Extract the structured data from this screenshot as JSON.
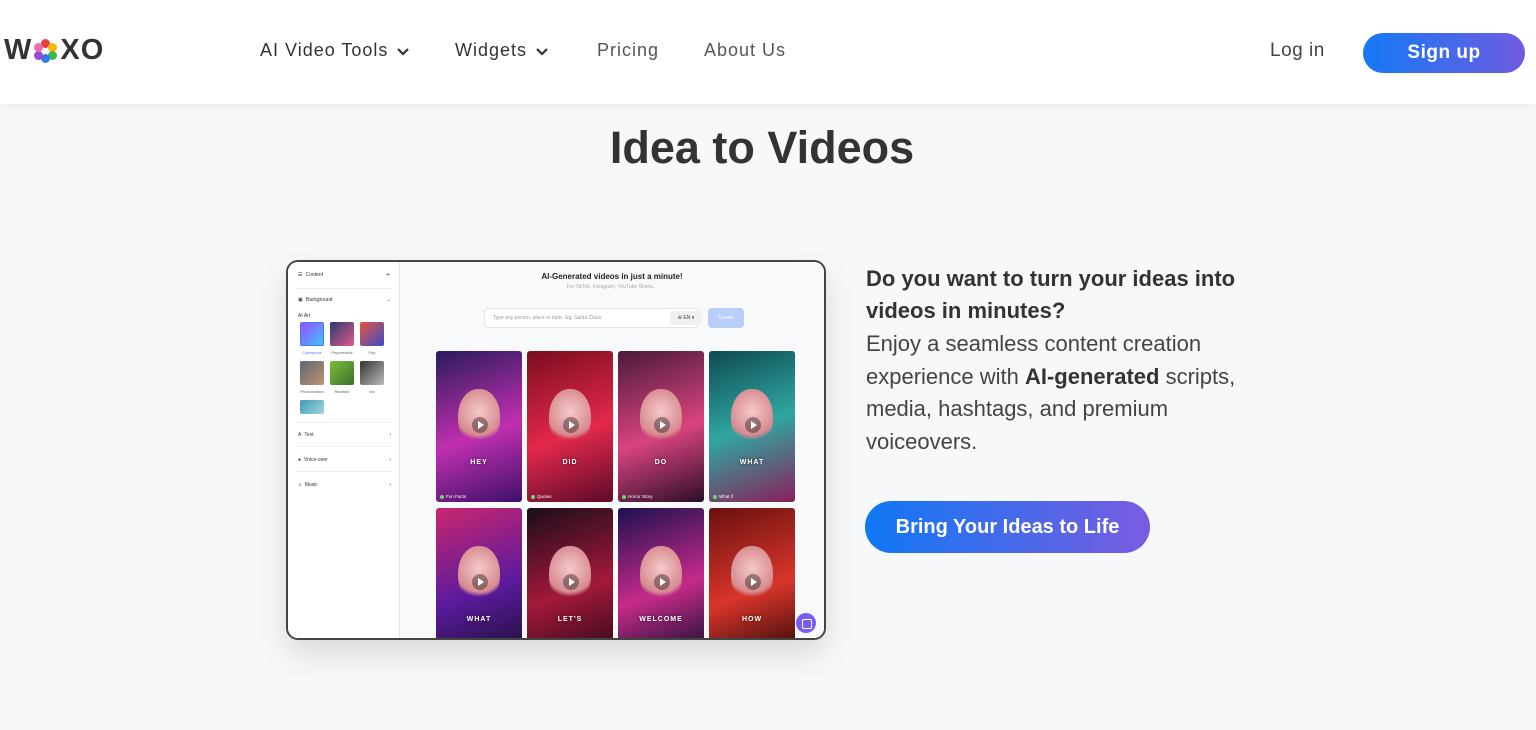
{
  "brand": {
    "logo_prefix": "W",
    "logo_suffix": "XO",
    "accent_gradient": [
      "#1479f5",
      "#6f5ce0"
    ],
    "flower_colors": [
      "#e8403f",
      "#f7b500",
      "#3cb94a",
      "#2f7be8",
      "#9a4ad6",
      "#ef6bb0"
    ]
  },
  "nav": {
    "items": [
      {
        "label": "AI Video Tools",
        "has_dropdown": true
      },
      {
        "label": "Widgets",
        "has_dropdown": true
      },
      {
        "label": "Pricing",
        "has_dropdown": false
      },
      {
        "label": "About Us",
        "has_dropdown": false
      }
    ],
    "login_label": "Log in",
    "signup_label": "Sign up"
  },
  "hero": {
    "title": "Idea to Videos"
  },
  "mockup": {
    "sidebar": {
      "content_label": "Content",
      "background_label": "Background",
      "ai_art_label": "AI Art",
      "styles": [
        "Cyberpunk",
        "Psychedelic",
        "Pop",
        "Photorealism",
        "Realistic",
        "Ink"
      ],
      "text_label": "Text",
      "voiceover_label": "Voice-over",
      "music_label": "Music"
    },
    "heading": "AI-Generated videos in just a minute!",
    "subheading": "For TikTok, Instagram, YouTube Shorts...",
    "input_placeholder": "Type any person, place or topic. Eg. Santa Claus",
    "language": "EN",
    "create_label": "Create",
    "cards": [
      {
        "caption": "HEY",
        "tag": "Fun Facts"
      },
      {
        "caption": "DID",
        "tag": "Quotes"
      },
      {
        "caption": "DO",
        "tag": "Horror Story"
      },
      {
        "caption": "WHAT",
        "tag": "What if"
      },
      {
        "caption": "WHAT",
        "tag": ""
      },
      {
        "caption": "LET'S",
        "tag": ""
      },
      {
        "caption": "WELCOME",
        "tag": ""
      },
      {
        "caption": "HOW",
        "tag": ""
      }
    ]
  },
  "copy": {
    "question": "Do you want to turn your ideas into videos in minutes?",
    "body_before": "Enjoy a seamless content creation experience with ",
    "body_bold": "AI-generated",
    "body_after": " scripts, media, hashtags, and premium voiceovers.",
    "cta_label": "Bring Your Ideas to Life"
  }
}
